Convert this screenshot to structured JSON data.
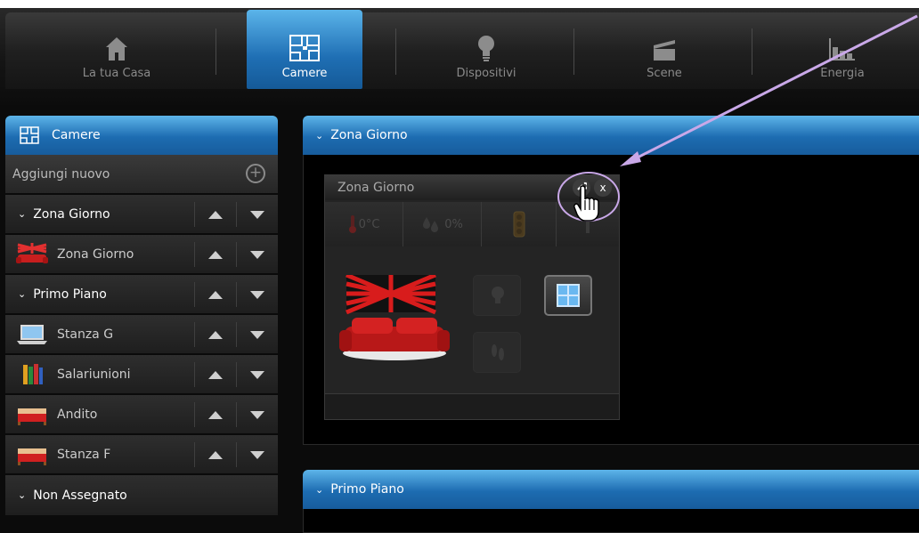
{
  "nav": {
    "items": [
      {
        "label": "La tua Casa",
        "icon": "house-icon"
      },
      {
        "label": "Camere",
        "icon": "floorplan-icon"
      },
      {
        "label": "Dispositivi",
        "icon": "lightbulb-icon"
      },
      {
        "label": "Scene",
        "icon": "clapperboard-icon"
      },
      {
        "label": "Energia",
        "icon": "bar-chart-icon"
      }
    ],
    "active": "Camere"
  },
  "sidebar": {
    "title": "Camere",
    "add_label": "Aggiungi nuovo",
    "groups": [
      {
        "label": "Zona Giorno",
        "rooms": [
          {
            "label": "Zona Giorno",
            "icon": "sofa-icon"
          }
        ]
      },
      {
        "label": "Primo Piano",
        "rooms": [
          {
            "label": "Stanza G",
            "icon": "laptop-icon"
          },
          {
            "label": "Salariunioni",
            "icon": "books-icon"
          },
          {
            "label": "Andito",
            "icon": "bed-icon"
          },
          {
            "label": "Stanza F",
            "icon": "bed-icon"
          }
        ]
      },
      {
        "label": "Non Assegnato",
        "rooms": []
      }
    ]
  },
  "panels": [
    {
      "title": "Zona Giorno"
    },
    {
      "title": "Primo Piano"
    }
  ],
  "card": {
    "title": "Zona Giorno",
    "edit_icon": "wrench-icon",
    "close_label": "x",
    "sensors": [
      {
        "icon": "thermometer-icon",
        "value": "0°C"
      },
      {
        "icon": "humidity-icon",
        "value": "0%"
      },
      {
        "icon": "traffic-light-icon",
        "value": ""
      },
      {
        "icon": "motion-icon",
        "value": ""
      }
    ],
    "devices": [
      {
        "icon": "lightbulb-icon",
        "state": "inactive"
      },
      {
        "icon": "window-icon",
        "state": "active"
      },
      {
        "icon": "footprints-icon",
        "state": "inactive"
      }
    ]
  },
  "colors": {
    "accent": "#1d6cb1",
    "annotation": "#c9a8e8"
  }
}
